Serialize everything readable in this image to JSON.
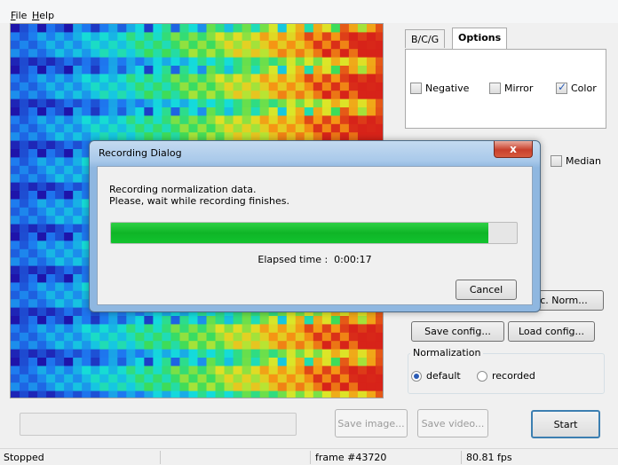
{
  "menu": {
    "file": "File",
    "file_hotkey": "F",
    "file_rest": "ile",
    "help": "Help",
    "help_hotkey": "H",
    "help_rest": "elp"
  },
  "tabs": [
    {
      "label": "B/C/G"
    },
    {
      "label": "Options"
    }
  ],
  "options": {
    "negative": {
      "label": "Negative",
      "checked": false
    },
    "mirror": {
      "label": "Mirror",
      "checked": false
    },
    "color": {
      "label": "Color",
      "checked": true
    },
    "median": {
      "label": "Median",
      "checked": false
    }
  },
  "buttons": {
    "norm_partial": "c. Norm...",
    "save_config": "Save config...",
    "load_config": "Load config...",
    "save_image": "Save image...",
    "save_video": "Save video...",
    "start": "Start"
  },
  "normalization": {
    "title": "Normalization",
    "default": "default",
    "recorded": "recorded",
    "selected": "default"
  },
  "status": {
    "state": "Stopped",
    "frame": "frame #43720",
    "fps": "80.81 fps"
  },
  "dialog": {
    "title": "Recording Dialog",
    "close": "x",
    "line1": "Recording normalization data.",
    "line2": "Please, wait while recording finishes.",
    "progress": 0.93,
    "elapsed_label": "Elapsed time :",
    "elapsed_value": "0:00:17",
    "cancel": "Cancel"
  },
  "colors": {
    "accent": "#2a5bb5",
    "progress": "#12c32e",
    "heat_low": "#1a1aa0",
    "heat_high": "#d42020"
  },
  "icons": {
    "chevron": "chevron-down-icon",
    "close": "close-icon"
  }
}
